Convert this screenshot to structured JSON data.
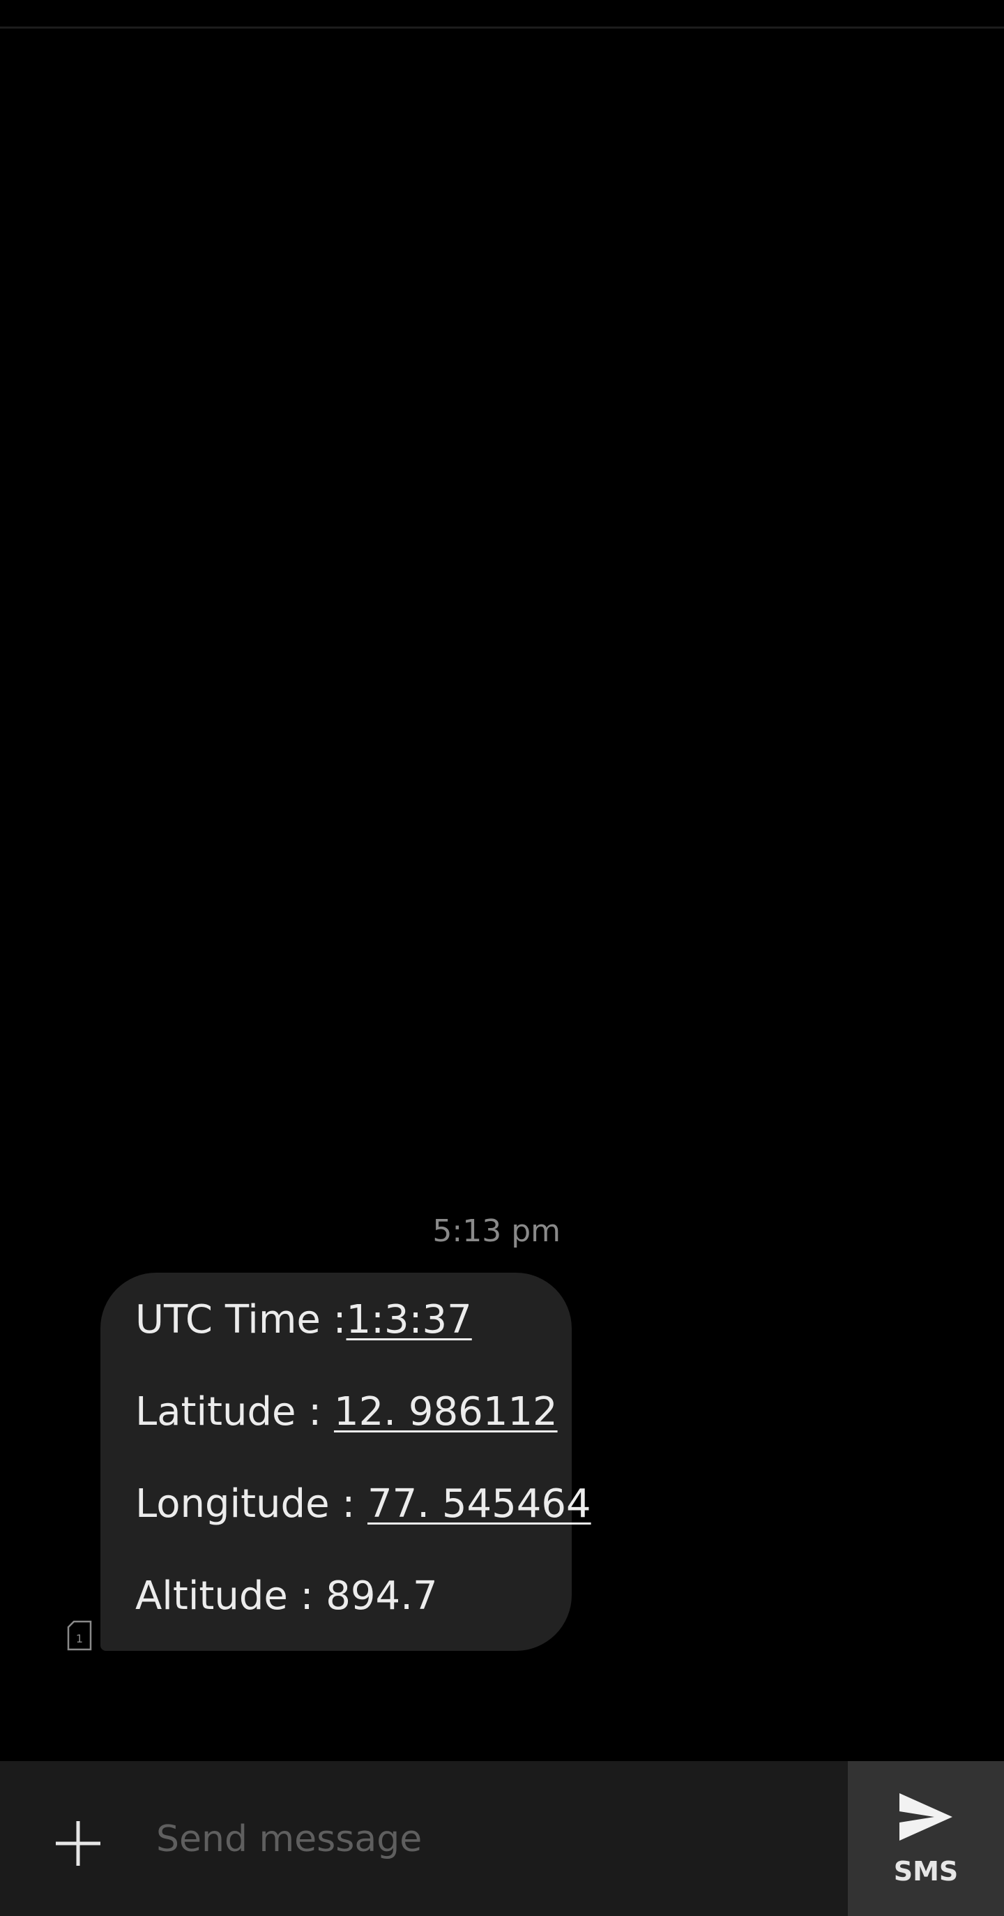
{
  "conversation": {
    "messages": [
      {
        "timestamp": "5:13 pm",
        "sim_slot": "1",
        "lines": [
          {
            "label": "UTC Time :",
            "value": "1:3:37"
          },
          {
            "label": "Latitude : ",
            "value": "12. 986112"
          },
          {
            "label": "Longitude : ",
            "value": "77. 545464"
          },
          {
            "label": "Altitude : 894.7",
            "value": ""
          }
        ]
      }
    ]
  },
  "composer": {
    "placeholder": "Send message",
    "value": "",
    "attach_icon": "plus-icon",
    "send_icon": "send-arrow-icon",
    "send_label": "SMS"
  },
  "colors": {
    "background": "#000000",
    "bubble": "#222222",
    "composer": "#1b1b1b",
    "send_button": "#333333",
    "timestamp": "#8a8a8a",
    "placeholder": "#5f5f5f"
  }
}
